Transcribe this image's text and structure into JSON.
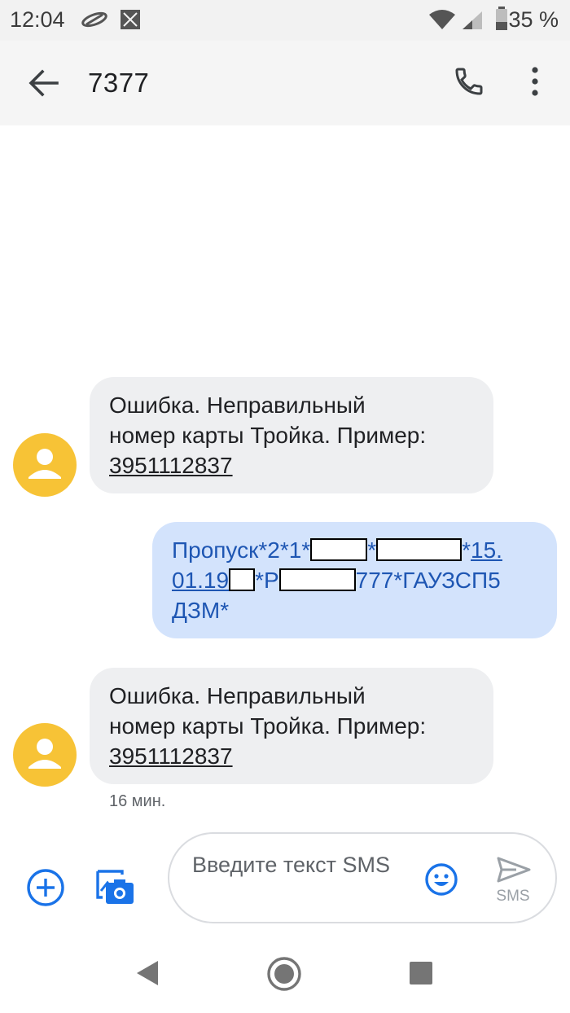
{
  "status_bar": {
    "time": "12:04",
    "battery_text": "35 %",
    "icons": [
      "notification-icon",
      "screenshot-icon",
      "wifi-icon",
      "signal-icon",
      "battery-icon"
    ]
  },
  "header": {
    "title": "7377",
    "back_icon": "arrow-left-icon",
    "call_icon": "phone-icon",
    "menu_icon": "more-vert-icon"
  },
  "messages": [
    {
      "direction": "incoming",
      "lines": [
        "Ошибка. Неправильный",
        "номер карты Тройка. Пример:"
      ],
      "link": "3951112837"
    },
    {
      "direction": "outgoing",
      "parts": {
        "p1": "Пропуск*2*1*",
        "p2": "*",
        "p3": "*",
        "p4": "15.",
        "p5": "01.19",
        "p6": "*Р",
        "p7": "777*ГАУЗСП5",
        "p8": "ДЗМ*"
      }
    },
    {
      "direction": "incoming",
      "lines": [
        "Ошибка. Неправильный",
        "номер карты Тройка. Пример:"
      ],
      "link": "3951112837",
      "timestamp": "16 мин."
    }
  ],
  "compose": {
    "placeholder": "Введите текст SMS",
    "send_label": "SMS"
  },
  "colors": {
    "avatar": "#f7c336",
    "incoming_bubble": "#eeeff1",
    "outgoing_bubble": "#d3e3fc",
    "outgoing_text": "#1e56b3",
    "accent": "#1a73e8"
  }
}
